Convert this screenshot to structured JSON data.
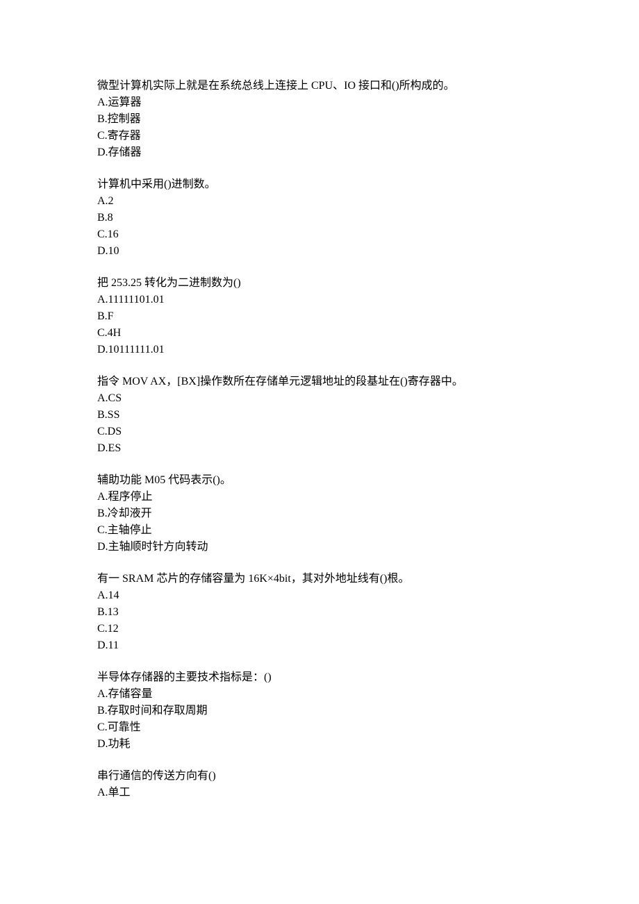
{
  "questions": [
    {
      "text": "微型计算机实际上就是在系统总线上连接上 CPU、IO 接口和()所构成的。",
      "options": [
        "A.运算器",
        "B.控制器",
        "C.寄存器",
        "D.存储器"
      ]
    },
    {
      "text": "计算机中采用()进制数。",
      "options": [
        "A.2",
        "B.8",
        "C.16",
        "D.10"
      ]
    },
    {
      "text": "把 253.25 转化为二进制数为()",
      "options": [
        "A.11111101.01",
        "B.F",
        "C.4H",
        "D.10111111.01"
      ]
    },
    {
      "text": "指令 MOV AX，[BX]操作数所在存储单元逻辑地址的段基址在()寄存器中。",
      "options": [
        "A.CS",
        "B.SS",
        "C.DS",
        "D.ES"
      ]
    },
    {
      "text": "辅助功能 M05 代码表示()。",
      "options": [
        "A.程序停止",
        "B.冷却液开",
        "C.主轴停止",
        "D.主轴顺时针方向转动"
      ]
    },
    {
      "text": "有一 SRAM 芯片的存储容量为 16K×4bit，其对外地址线有()根。",
      "options": [
        "A.14",
        "B.13",
        "C.12",
        "D.11"
      ]
    },
    {
      "text": "半导体存储器的主要技术指标是：()",
      "options": [
        "A.存储容量",
        "B.存取时间和存取周期",
        "C.可靠性",
        "D.功耗"
      ]
    },
    {
      "text": "串行通信的传送方向有()",
      "options": [
        "A.单工"
      ]
    }
  ]
}
